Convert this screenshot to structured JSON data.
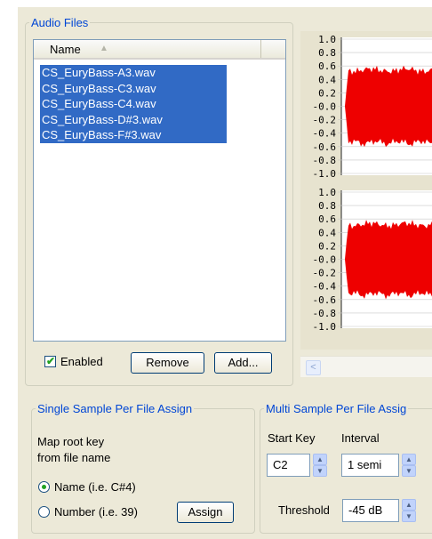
{
  "audio_files": {
    "group_title": "Audio Files",
    "column_name": "Name",
    "sort_indicator": "▲",
    "files": [
      "CS_EuryBass-A3.wav",
      "CS_EuryBass-C3.wav",
      "CS_EuryBass-C4.wav",
      "CS_EuryBass-D#3.wav",
      "CS_EuryBass-F#3.wav"
    ],
    "enabled_label": "Enabled",
    "enabled_checked": true,
    "remove_label": "Remove",
    "add_label": "Add..."
  },
  "waveform": {
    "ticks": [
      "1.0",
      "0.8",
      "0.6",
      "0.4",
      "0.2",
      "-0.0",
      "-0.2",
      "-0.4",
      "-0.6",
      "-0.8",
      "-1.0"
    ],
    "color": "#ee0000",
    "scroll_left_glyph": "<"
  },
  "single_assign": {
    "group_title": "Single Sample Per File Assign",
    "map_label_line1": "Map root key",
    "map_label_line2": "from file name",
    "radio_name_label": "Name (i.e. C#4)",
    "radio_number_label": "Number (i.e. 39)",
    "selected": "name",
    "assign_label": "Assign"
  },
  "multi_assign": {
    "group_title": "Multi Sample Per File Assig",
    "start_key_label": "Start Key",
    "start_key_value": "C2",
    "interval_label": "Interval",
    "interval_value": "1 semi",
    "threshold_label": "Threshold",
    "threshold_value": "-45 dB"
  },
  "colors": {
    "selection": "#316ac5",
    "group_title": "#0046d5",
    "panel": "#ece9d8"
  }
}
